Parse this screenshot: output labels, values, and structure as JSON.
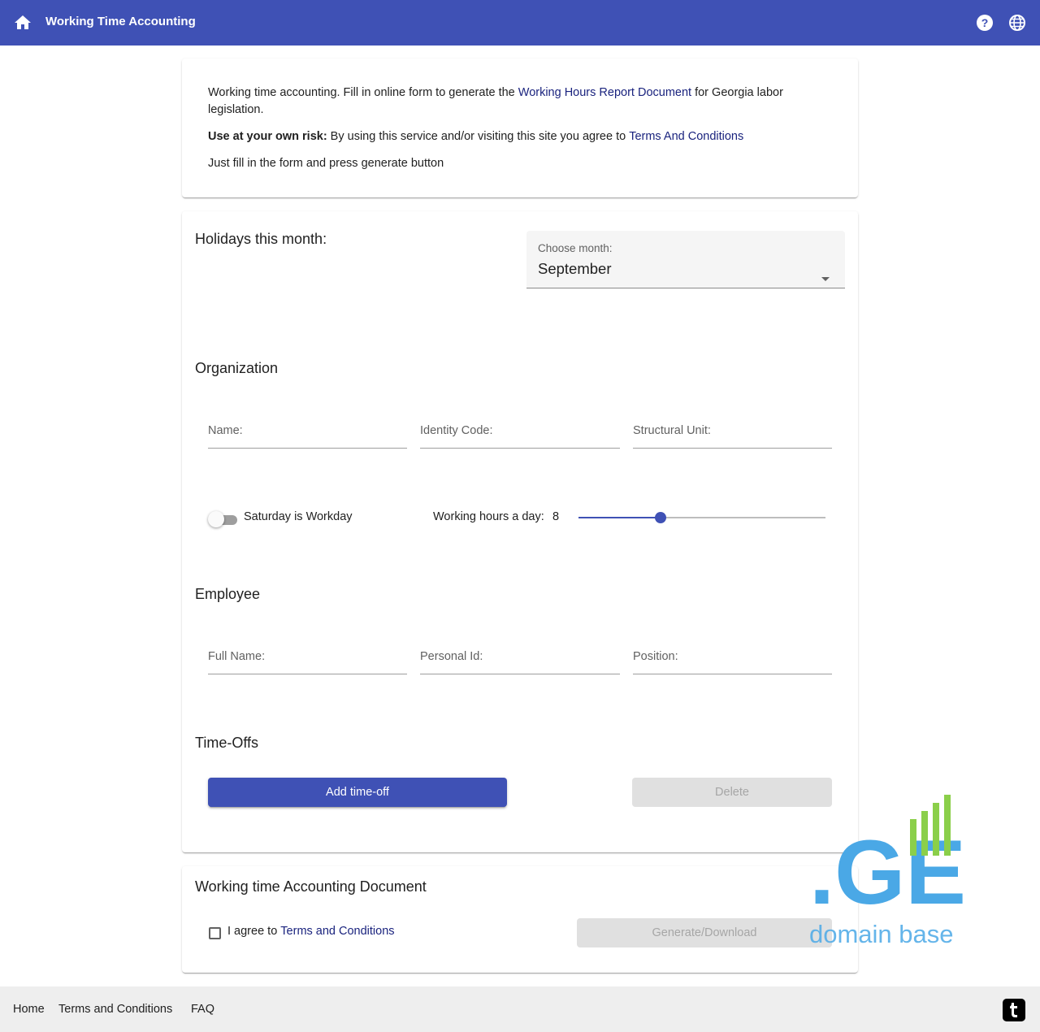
{
  "header": {
    "title": "Working Time Accounting",
    "home_icon": "home-icon",
    "help_icon": "help-icon",
    "language_icon": "globe-icon",
    "bar_color": "#3f51b5"
  },
  "intro": {
    "text_before_link": "Working time accounting. Fill in online form to generate the ",
    "report_link": "Working Hours Report Document",
    "text_after_link": " for Georgia labor legislation.",
    "risk_label": "Use at your own risk:",
    "risk_text": " By using this service and/or visiting this site you agree to ",
    "terms_link": "Terms And Conditions",
    "instruction": "Just fill in the form and press generate button"
  },
  "holidays": {
    "heading": "Holidays this month:",
    "month_label": "Choose month:",
    "month_value": "September"
  },
  "organization": {
    "heading": "Organization",
    "name_label": "Name:",
    "identity_label": "Identity Code:",
    "unit_label": "Structural Unit:",
    "saturday_label": "Saturday is Workday",
    "saturday_on": false,
    "hours_label": "Working hours a day:",
    "hours_value": "8",
    "hours_min": 0,
    "hours_max": 24,
    "hours_fraction": 0.333
  },
  "employee": {
    "heading": "Employee",
    "fullname_label": "Full Name:",
    "personal_id_label": "Personal Id:",
    "position_label": "Position:"
  },
  "timeoffs": {
    "heading": "Time-Offs",
    "add_button": "Add time-off",
    "delete_button": "Delete"
  },
  "document": {
    "heading": "Working time Accounting Document",
    "agree_prefix": "I agree to ",
    "agree_link": "Terms and Conditions",
    "generate_button": "Generate/Download"
  },
  "watermark": {
    "brand": ".GE",
    "tagline": "domain base"
  },
  "footer": {
    "home": "Home",
    "terms": "Terms and Conditions",
    "faq": "FAQ",
    "social_icon": "tumblr-icon"
  }
}
